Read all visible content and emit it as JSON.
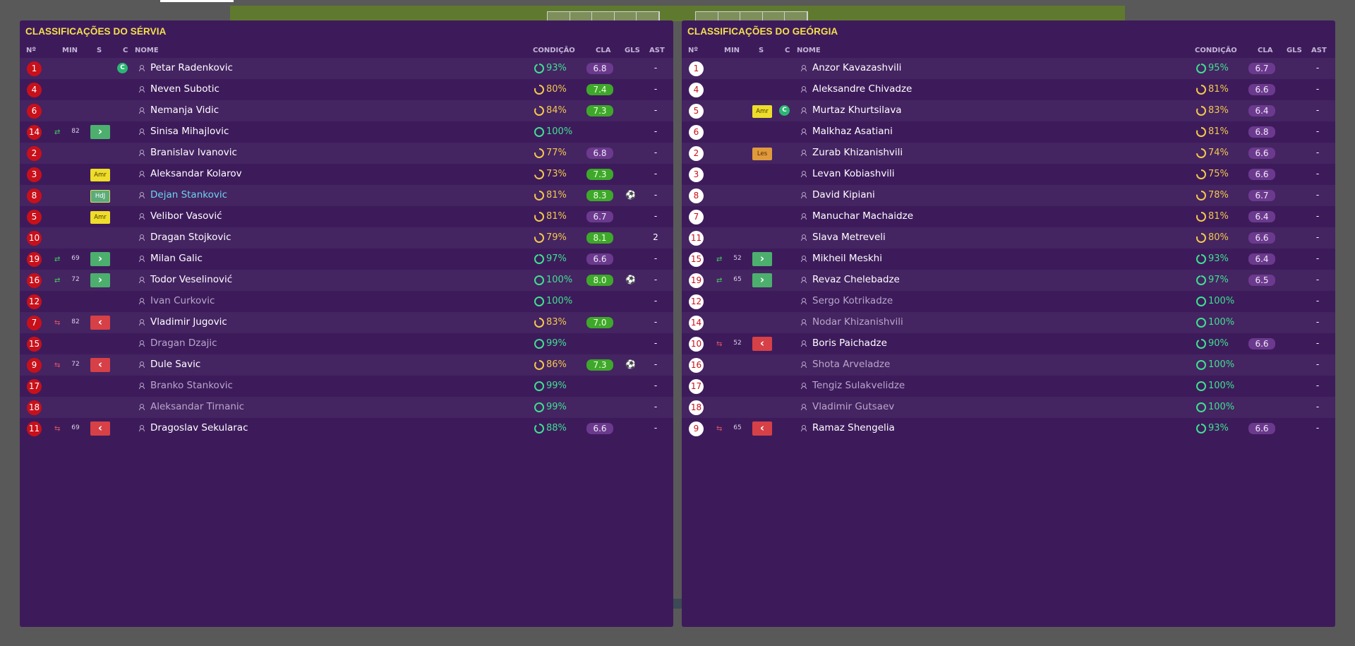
{
  "colors": {
    "panel": "#3d1b5b",
    "title": "#f4e04d",
    "serbia_number_bg": "#c9101a",
    "georgia_number_bg": "#ffffff",
    "condition_green": "#3fe090",
    "condition_yellow": "#f2c94c",
    "rating_green": "#3ea82a",
    "rating_purple": "#6b3a8e",
    "sub_in": "#4caf6e",
    "sub_out": "#d64046"
  },
  "headers": {
    "no": "Nº",
    "min": "MIN",
    "s": "S",
    "c": "C",
    "name": "NOME",
    "condition": "CONDIÇÃO",
    "cla": "CLA",
    "gls": "GLS",
    "ast": "AST"
  },
  "teams": [
    {
      "title": "CLASSIFICAÇÕES DO SÉRVIA",
      "players": [
        {
          "num": "1",
          "name": "Petar Radenkovic",
          "captain": "C",
          "cond": "93%",
          "cond_color": "green",
          "cond_fill": 0.93,
          "cla": "6.8",
          "cla_color": "purple",
          "ast": "-"
        },
        {
          "num": "4",
          "name": "Neven Subotic",
          "cond": "80%",
          "cond_color": "yellow",
          "cond_fill": 0.8,
          "cla": "7.4",
          "cla_color": "green",
          "ast": "-"
        },
        {
          "num": "6",
          "name": "Nemanja Vidic",
          "cond": "84%",
          "cond_color": "yellow",
          "cond_fill": 0.84,
          "cla": "7.3",
          "cla_color": "green",
          "ast": "-"
        },
        {
          "num": "14",
          "min": "82",
          "sub": "in",
          "name": "Sinisa Mihajlovic",
          "cond": "100%",
          "cond_color": "green",
          "cond_fill": 1.0,
          "ast": "-"
        },
        {
          "num": "2",
          "name": "Branislav Ivanovic",
          "cond": "77%",
          "cond_color": "yellow",
          "cond_fill": 0.77,
          "cla": "6.8",
          "cla_color": "purple",
          "ast": "-"
        },
        {
          "num": "3",
          "card": "Amr",
          "card_type": "yellow",
          "name": "Aleksandar Kolarov",
          "cond": "73%",
          "cond_color": "yellow",
          "cond_fill": 0.73,
          "cla": "7.3",
          "cla_color": "green",
          "ast": "-"
        },
        {
          "num": "8",
          "card": "HdJ",
          "card_type": "hoj",
          "name": "Dejan Stankovic",
          "highlight": true,
          "cond": "81%",
          "cond_color": "yellow",
          "cond_fill": 0.81,
          "cla": "8.3",
          "cla_color": "green",
          "gls": "⚽",
          "ast": "-"
        },
        {
          "num": "5",
          "card": "Amr",
          "card_type": "yellow",
          "name": "Velibor Vasović",
          "cond": "81%",
          "cond_color": "yellow",
          "cond_fill": 0.81,
          "cla": "6.7",
          "cla_color": "purple",
          "ast": "-"
        },
        {
          "num": "10",
          "name": "Dragan Stojkovic",
          "cond": "79%",
          "cond_color": "yellow",
          "cond_fill": 0.79,
          "cla": "8.1",
          "cla_color": "green",
          "ast": "2"
        },
        {
          "num": "19",
          "min": "69",
          "sub": "in",
          "name": "Milan Galic",
          "cond": "97%",
          "cond_color": "green",
          "cond_fill": 0.97,
          "cla": "6.6",
          "cla_color": "purple",
          "ast": "-"
        },
        {
          "num": "16",
          "min": "72",
          "sub": "in",
          "name": "Todor Veselinović",
          "cond": "100%",
          "cond_color": "green",
          "cond_fill": 1.0,
          "cla": "8.0",
          "cla_color": "green",
          "gls": "⚽",
          "ast": "-"
        },
        {
          "num": "12",
          "name": "Ivan Curkovic",
          "dim": true,
          "cond": "100%",
          "cond_color": "green",
          "cond_fill": 1.0,
          "ast": "-"
        },
        {
          "num": "7",
          "min": "82",
          "sub": "out",
          "name": "Vladimir Jugovic",
          "cond": "83%",
          "cond_color": "yellow",
          "cond_fill": 0.83,
          "cla": "7.0",
          "cla_color": "green",
          "ast": "-"
        },
        {
          "num": "15",
          "name": "Dragan Dzajic",
          "dim": true,
          "cond": "99%",
          "cond_color": "green",
          "cond_fill": 0.99,
          "ast": "-"
        },
        {
          "num": "9",
          "min": "72",
          "sub": "out",
          "name": "Dule Savic",
          "cond": "86%",
          "cond_color": "yellow",
          "cond_fill": 0.86,
          "cla": "7.3",
          "cla_color": "green",
          "gls": "⚽",
          "ast": "-"
        },
        {
          "num": "17",
          "name": "Branko Stankovic",
          "dim": true,
          "cond": "99%",
          "cond_color": "green",
          "cond_fill": 0.99,
          "ast": "-"
        },
        {
          "num": "18",
          "name": "Aleksandar Tirnanic",
          "dim": true,
          "cond": "99%",
          "cond_color": "green",
          "cond_fill": 0.99,
          "ast": "-"
        },
        {
          "num": "11",
          "min": "69",
          "sub": "out",
          "name": "Dragoslav Sekularac",
          "cond": "88%",
          "cond_color": "green",
          "cond_fill": 0.88,
          "cla": "6.6",
          "cla_color": "purple",
          "ast": "-"
        }
      ]
    },
    {
      "title": "CLASSIFICAÇÕES DO GEÓRGIA",
      "players": [
        {
          "num": "1",
          "name": "Anzor Kavazashvili",
          "cond": "95%",
          "cond_color": "green",
          "cond_fill": 0.95,
          "cla": "6.7",
          "cla_color": "purple",
          "ast": "-"
        },
        {
          "num": "4",
          "name": "Aleksandre Chivadze",
          "cond": "81%",
          "cond_color": "yellow",
          "cond_fill": 0.81,
          "cla": "6.6",
          "cla_color": "purple",
          "ast": "-"
        },
        {
          "num": "5",
          "card": "Amr",
          "card_type": "yellow",
          "captain": "C",
          "name": "Murtaz Khurtsilava",
          "cond": "83%",
          "cond_color": "yellow",
          "cond_fill": 0.83,
          "cla": "6.4",
          "cla_color": "purple",
          "ast": "-"
        },
        {
          "num": "6",
          "name": "Malkhaz Asatiani",
          "cond": "81%",
          "cond_color": "yellow",
          "cond_fill": 0.81,
          "cla": "6.8",
          "cla_color": "purple",
          "ast": "-"
        },
        {
          "num": "2",
          "card": "Les",
          "card_type": "orange",
          "name": "Zurab Khizanishvili",
          "cond": "74%",
          "cond_color": "yellow",
          "cond_fill": 0.74,
          "cla": "6.6",
          "cla_color": "purple",
          "ast": "-"
        },
        {
          "num": "3",
          "name": "Levan Kobiashvili",
          "cond": "75%",
          "cond_color": "yellow",
          "cond_fill": 0.75,
          "cla": "6.6",
          "cla_color": "purple",
          "ast": "-"
        },
        {
          "num": "8",
          "name": "David Kipiani",
          "cond": "78%",
          "cond_color": "yellow",
          "cond_fill": 0.78,
          "cla": "6.7",
          "cla_color": "purple",
          "ast": "-"
        },
        {
          "num": "7",
          "name": "Manuchar Machaidze",
          "cond": "81%",
          "cond_color": "yellow",
          "cond_fill": 0.81,
          "cla": "6.4",
          "cla_color": "purple",
          "ast": "-"
        },
        {
          "num": "11",
          "name": "Slava Metreveli",
          "cond": "80%",
          "cond_color": "yellow",
          "cond_fill": 0.8,
          "cla": "6.6",
          "cla_color": "purple",
          "ast": "-"
        },
        {
          "num": "15",
          "min": "52",
          "sub": "in",
          "name": "Mikheil Meskhi",
          "cond": "93%",
          "cond_color": "green",
          "cond_fill": 0.93,
          "cla": "6.4",
          "cla_color": "purple",
          "ast": "-"
        },
        {
          "num": "19",
          "min": "65",
          "sub": "in",
          "name": "Revaz Chelebadze",
          "cond": "97%",
          "cond_color": "green",
          "cond_fill": 0.97,
          "cla": "6.5",
          "cla_color": "purple",
          "ast": "-"
        },
        {
          "num": "12",
          "name": "Sergo Kotrikadze",
          "dim": true,
          "cond": "100%",
          "cond_color": "green",
          "cond_fill": 1.0,
          "ast": "-"
        },
        {
          "num": "14",
          "name": "Nodar Khizanishvili",
          "dim": true,
          "cond": "100%",
          "cond_color": "green",
          "cond_fill": 1.0,
          "ast": "-"
        },
        {
          "num": "10",
          "min": "52",
          "sub": "out",
          "name": "Boris Paichadze",
          "cond": "90%",
          "cond_color": "green",
          "cond_fill": 0.9,
          "cla": "6.6",
          "cla_color": "purple",
          "ast": "-"
        },
        {
          "num": "16",
          "name": "Shota Arveladze",
          "dim": true,
          "cond": "100%",
          "cond_color": "green",
          "cond_fill": 1.0,
          "ast": "-"
        },
        {
          "num": "17",
          "name": "Tengiz Sulakvelidze",
          "dim": true,
          "cond": "100%",
          "cond_color": "green",
          "cond_fill": 1.0,
          "ast": "-"
        },
        {
          "num": "18",
          "name": "Vladimir Gutsaev",
          "dim": true,
          "cond": "100%",
          "cond_color": "green",
          "cond_fill": 1.0,
          "ast": "-"
        },
        {
          "num": "9",
          "min": "65",
          "sub": "out",
          "name": "Ramaz Shengelia",
          "cond": "93%",
          "cond_color": "green",
          "cond_fill": 0.93,
          "cla": "6.6",
          "cla_color": "purple",
          "ast": "-"
        }
      ]
    }
  ]
}
